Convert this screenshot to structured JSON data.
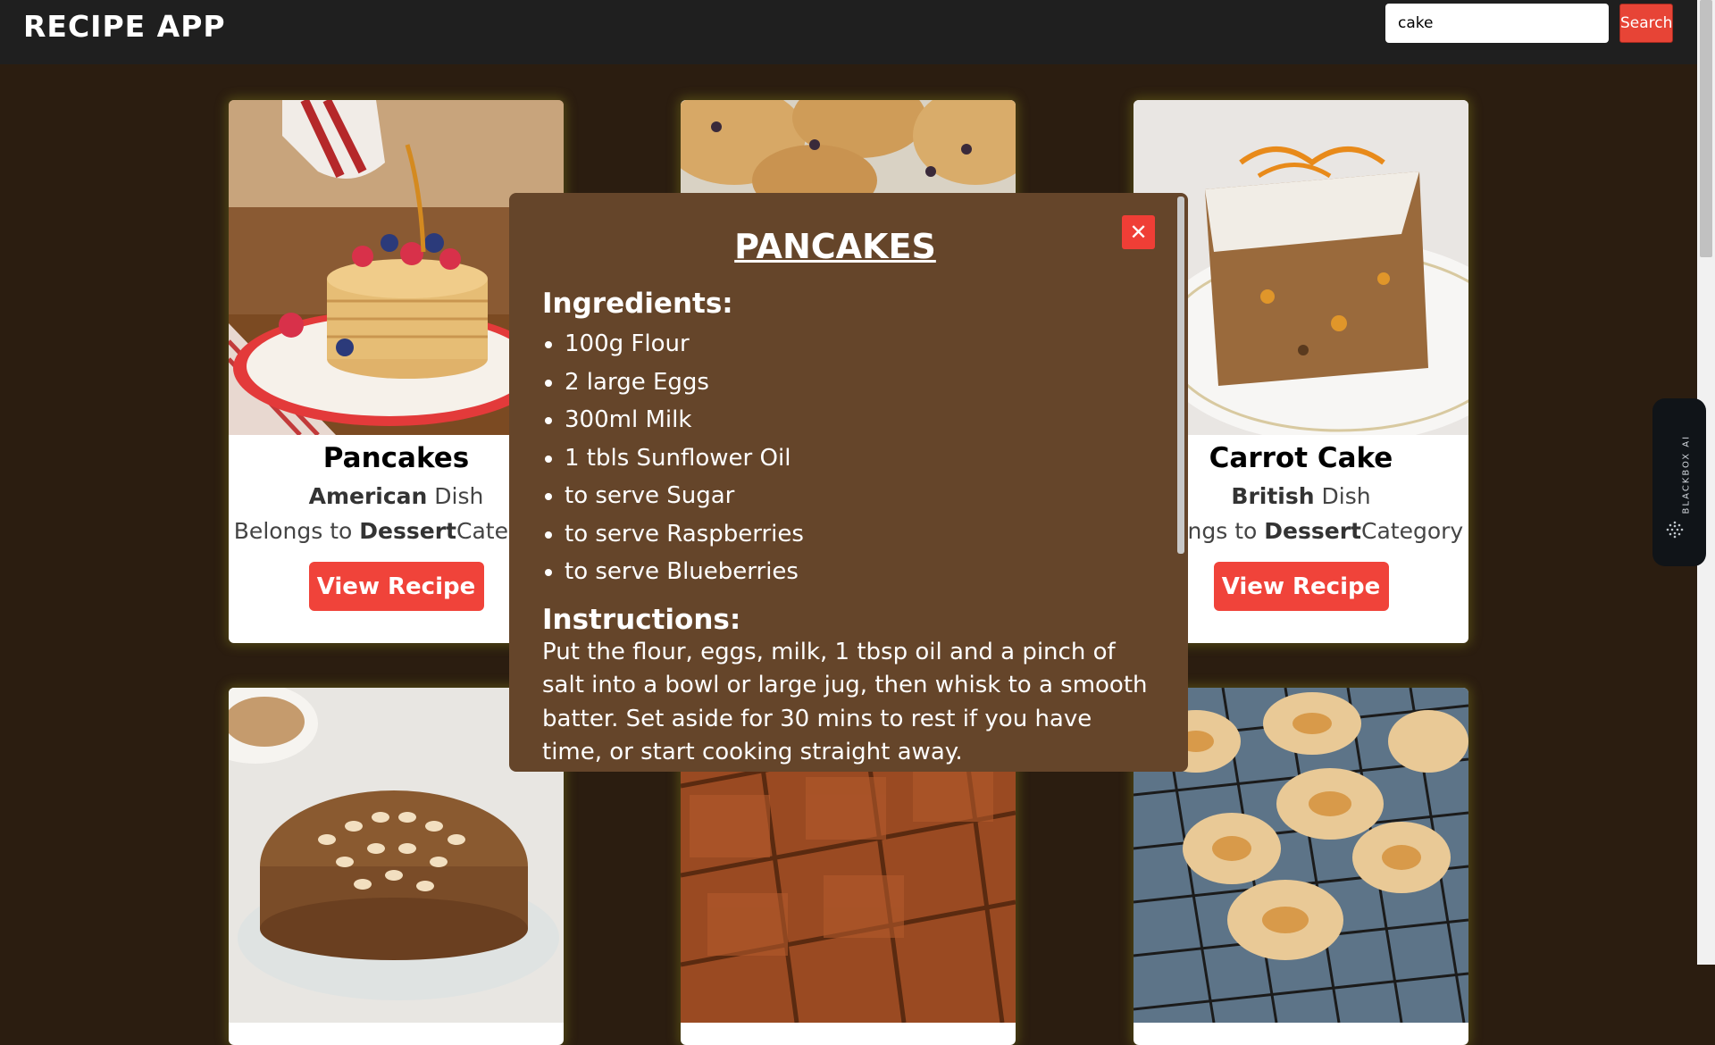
{
  "header": {
    "app_title": "RECIPE APP",
    "search_value": "cake",
    "search_button": "Search"
  },
  "cards": [
    {
      "title": "Pancakes",
      "area": "American",
      "dish_suffix": " Dish",
      "category_prefix": "Belongs to ",
      "category": "Dessert",
      "category_suffix": "Category",
      "button": "View Recipe"
    },
    {
      "title": "Carrot Cake",
      "area": "British",
      "dish_suffix": " Dish",
      "category_prefix": "Belongs to ",
      "category": "Dessert",
      "category_suffix": "Category",
      "button": "View Recipe"
    }
  ],
  "modal": {
    "title": "PANCAKES",
    "close_symbol": "✕",
    "ingredients_heading": "Ingredients:",
    "ingredients": [
      "100g Flour",
      "2 large Eggs",
      "300ml Milk",
      "1 tbls Sunflower Oil",
      "to serve Sugar",
      "to serve Raspberries",
      "to serve Blueberries"
    ],
    "instructions_heading": "Instructions:",
    "instructions_text": "Put the flour, eggs, milk, 1 tbsp oil and a pinch of salt into a bowl or large jug, then whisk to a smooth batter. Set aside for 30 mins to rest if you have time, or start cooking straight away."
  },
  "side_widget": {
    "label": "BLACKBOX AI"
  },
  "icons": {
    "close": "close-icon"
  },
  "colors": {
    "background": "#2b1d10",
    "header": "#1f1f1f",
    "accent": "#f0433a",
    "modal": "#65452a"
  }
}
